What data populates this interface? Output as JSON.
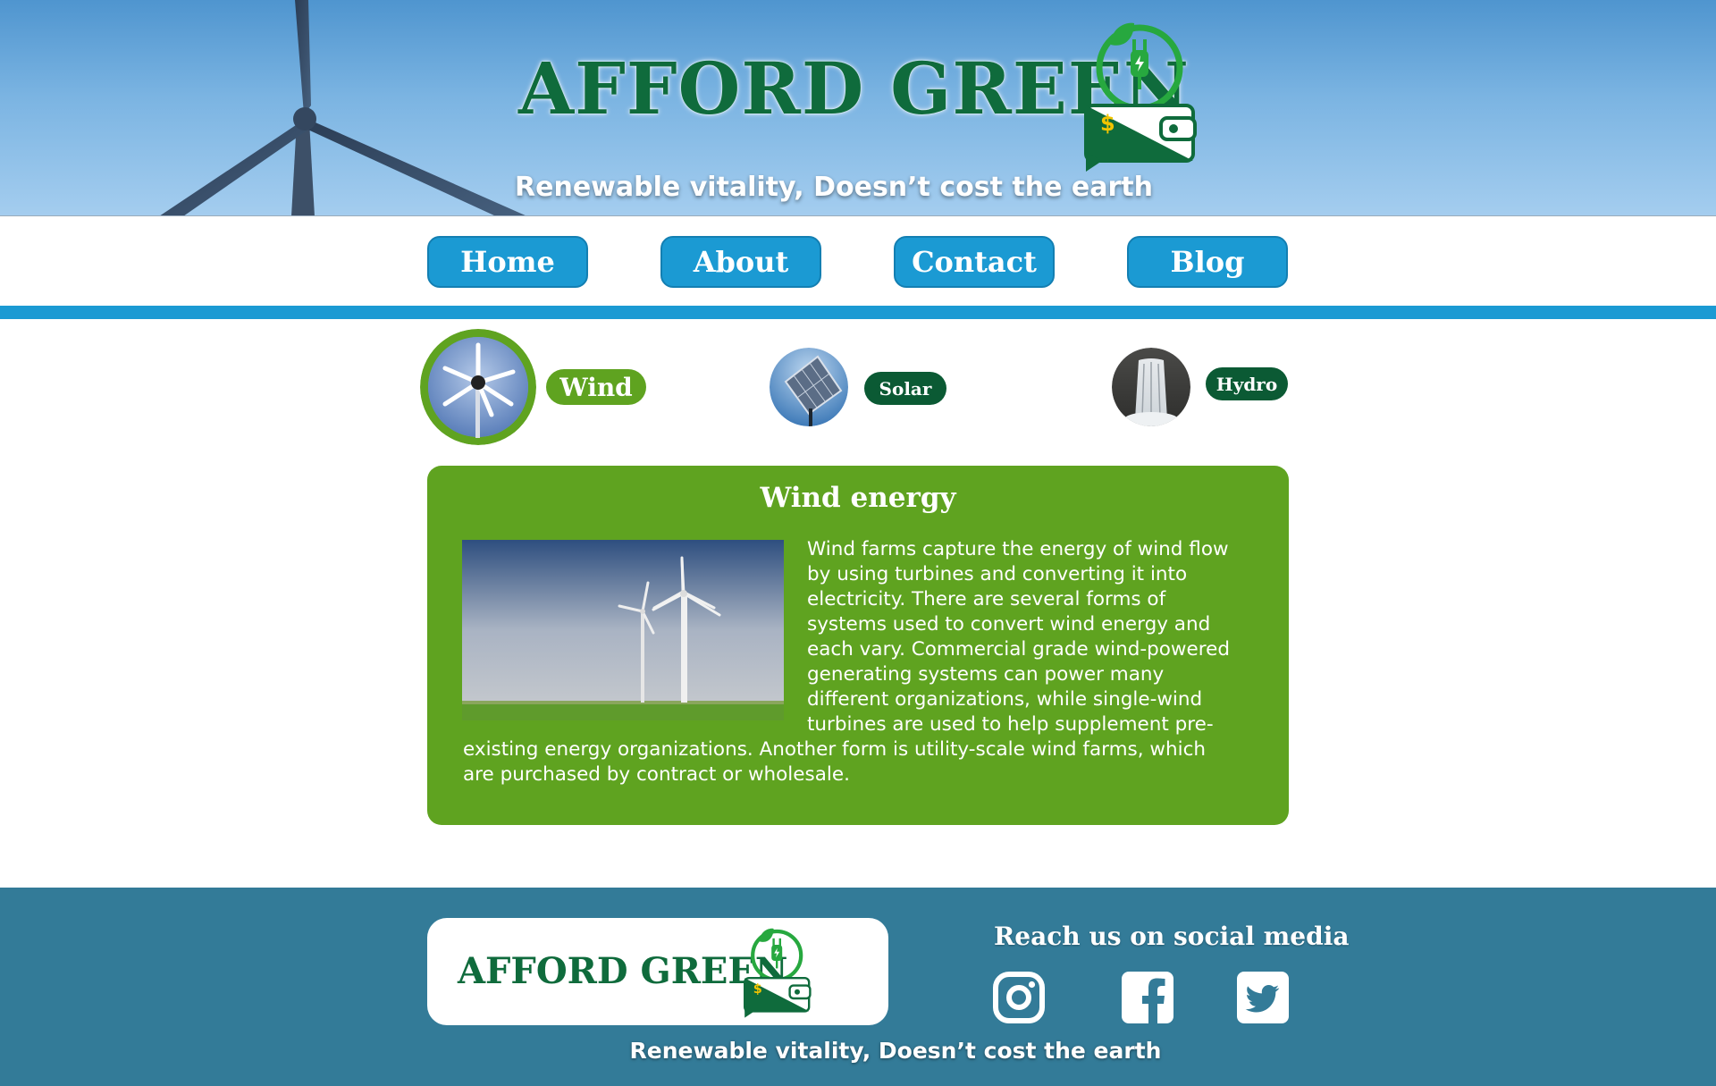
{
  "header": {
    "brand": "AFFORD GREEN",
    "tagline": "Renewable vitality, Doesn’t cost the earth"
  },
  "nav": {
    "items": [
      {
        "label": "Home"
      },
      {
        "label": "About"
      },
      {
        "label": "Contact"
      },
      {
        "label": "Blog"
      }
    ]
  },
  "selectors": [
    {
      "label": "Wind",
      "selected": true
    },
    {
      "label": "Solar",
      "selected": false
    },
    {
      "label": "Hydro",
      "selected": false
    }
  ],
  "content": {
    "title": "Wind energy",
    "body": "Wind farms capture the energy of wind flow by using turbines and converting it into electricity. There are several forms of systems used to convert wind energy and each vary. Commercial grade wind-powered generating systems can power many different organizations, while single-wind turbines are used to help supplement pre-existing energy organizations. Another form is utility-scale wind farms, which are purchased by contract or wholesale."
  },
  "footer": {
    "brand": "AFFORD GREEN",
    "social_title": "Reach us on social media",
    "social": [
      "instagram-icon",
      "facebook-icon",
      "twitter-icon"
    ],
    "tagline": "Renewable vitality, Doesn’t cost the earth"
  },
  "colors": {
    "brand_green": "#0f6b3c",
    "nav_blue": "#1b9ad3",
    "card_green": "#5fa320",
    "selected_green": "#5fa320",
    "label_dark_green": "#0b5a34",
    "footer_teal": "#337b98"
  }
}
